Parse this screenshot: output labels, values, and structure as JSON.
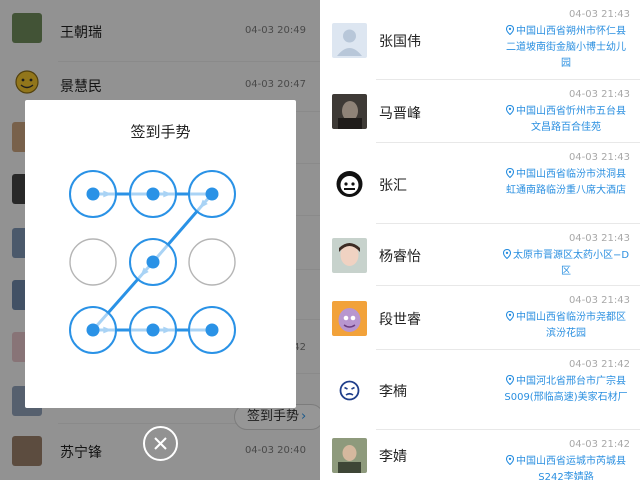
{
  "left_list": {
    "rows": [
      {
        "name": "王朝瑞",
        "time": "04-03 20:49"
      },
      {
        "name": "景慧民",
        "time": "04-03 20:47"
      },
      {
        "name": "",
        "time": ""
      },
      {
        "name": "",
        "time": ""
      },
      {
        "name": "",
        "time": ""
      },
      {
        "name": "",
        "time": ""
      },
      {
        "name": "",
        "time": "42"
      },
      {
        "name": "",
        "time": ""
      },
      {
        "name": "苏宁锋",
        "time": "04-03 20:40"
      }
    ],
    "checkin_button": "签到手势"
  },
  "gesture_dialog": {
    "title": "签到手势",
    "grid_rows": 3,
    "grid_cols": 3,
    "pattern_sequence": [
      1,
      2,
      3,
      5,
      7,
      8,
      9
    ],
    "colors": {
      "active": "#2a92e6",
      "inactive": "#b5b5b5"
    }
  },
  "close_icon": "close-icon",
  "right_list": {
    "items": [
      {
        "name": "张国伟",
        "time": "04-03 21:43",
        "address": "中国山西省朔州市怀仁县二道坡南街金脑小博士幼儿园",
        "avatar": "default-person-icon"
      },
      {
        "name": "马晋峰",
        "time": "04-03 21:43",
        "address": "中国山西省忻州市五台县文昌路百合佳苑",
        "avatar": "photo-avatar"
      },
      {
        "name": "张汇",
        "time": "04-03 21:43",
        "address": "中国山西省临汾市洪洞县虹通南路临汾重八席大酒店",
        "avatar": "panda-meme-avatar"
      },
      {
        "name": "杨睿怡",
        "time": "04-03 21:43",
        "address": "太原市晋源区太药小区−D区",
        "avatar": "girl-photo-avatar"
      },
      {
        "name": "段世睿",
        "time": "04-03 21:43",
        "address": "中国山西省临汾市尧都区滨汾花园",
        "avatar": "cartoon-avatar"
      },
      {
        "name": "李楠",
        "time": "04-03 21:42",
        "address": "中国河北省邢台市广宗县S009(邢临高速)美家石材厂",
        "avatar": "sad-face-icon"
      },
      {
        "name": "李婧",
        "time": "04-03 21:42",
        "address": "中国山西省运城市芮城县S242李婧路",
        "avatar": "photo-avatar-2"
      }
    ]
  }
}
